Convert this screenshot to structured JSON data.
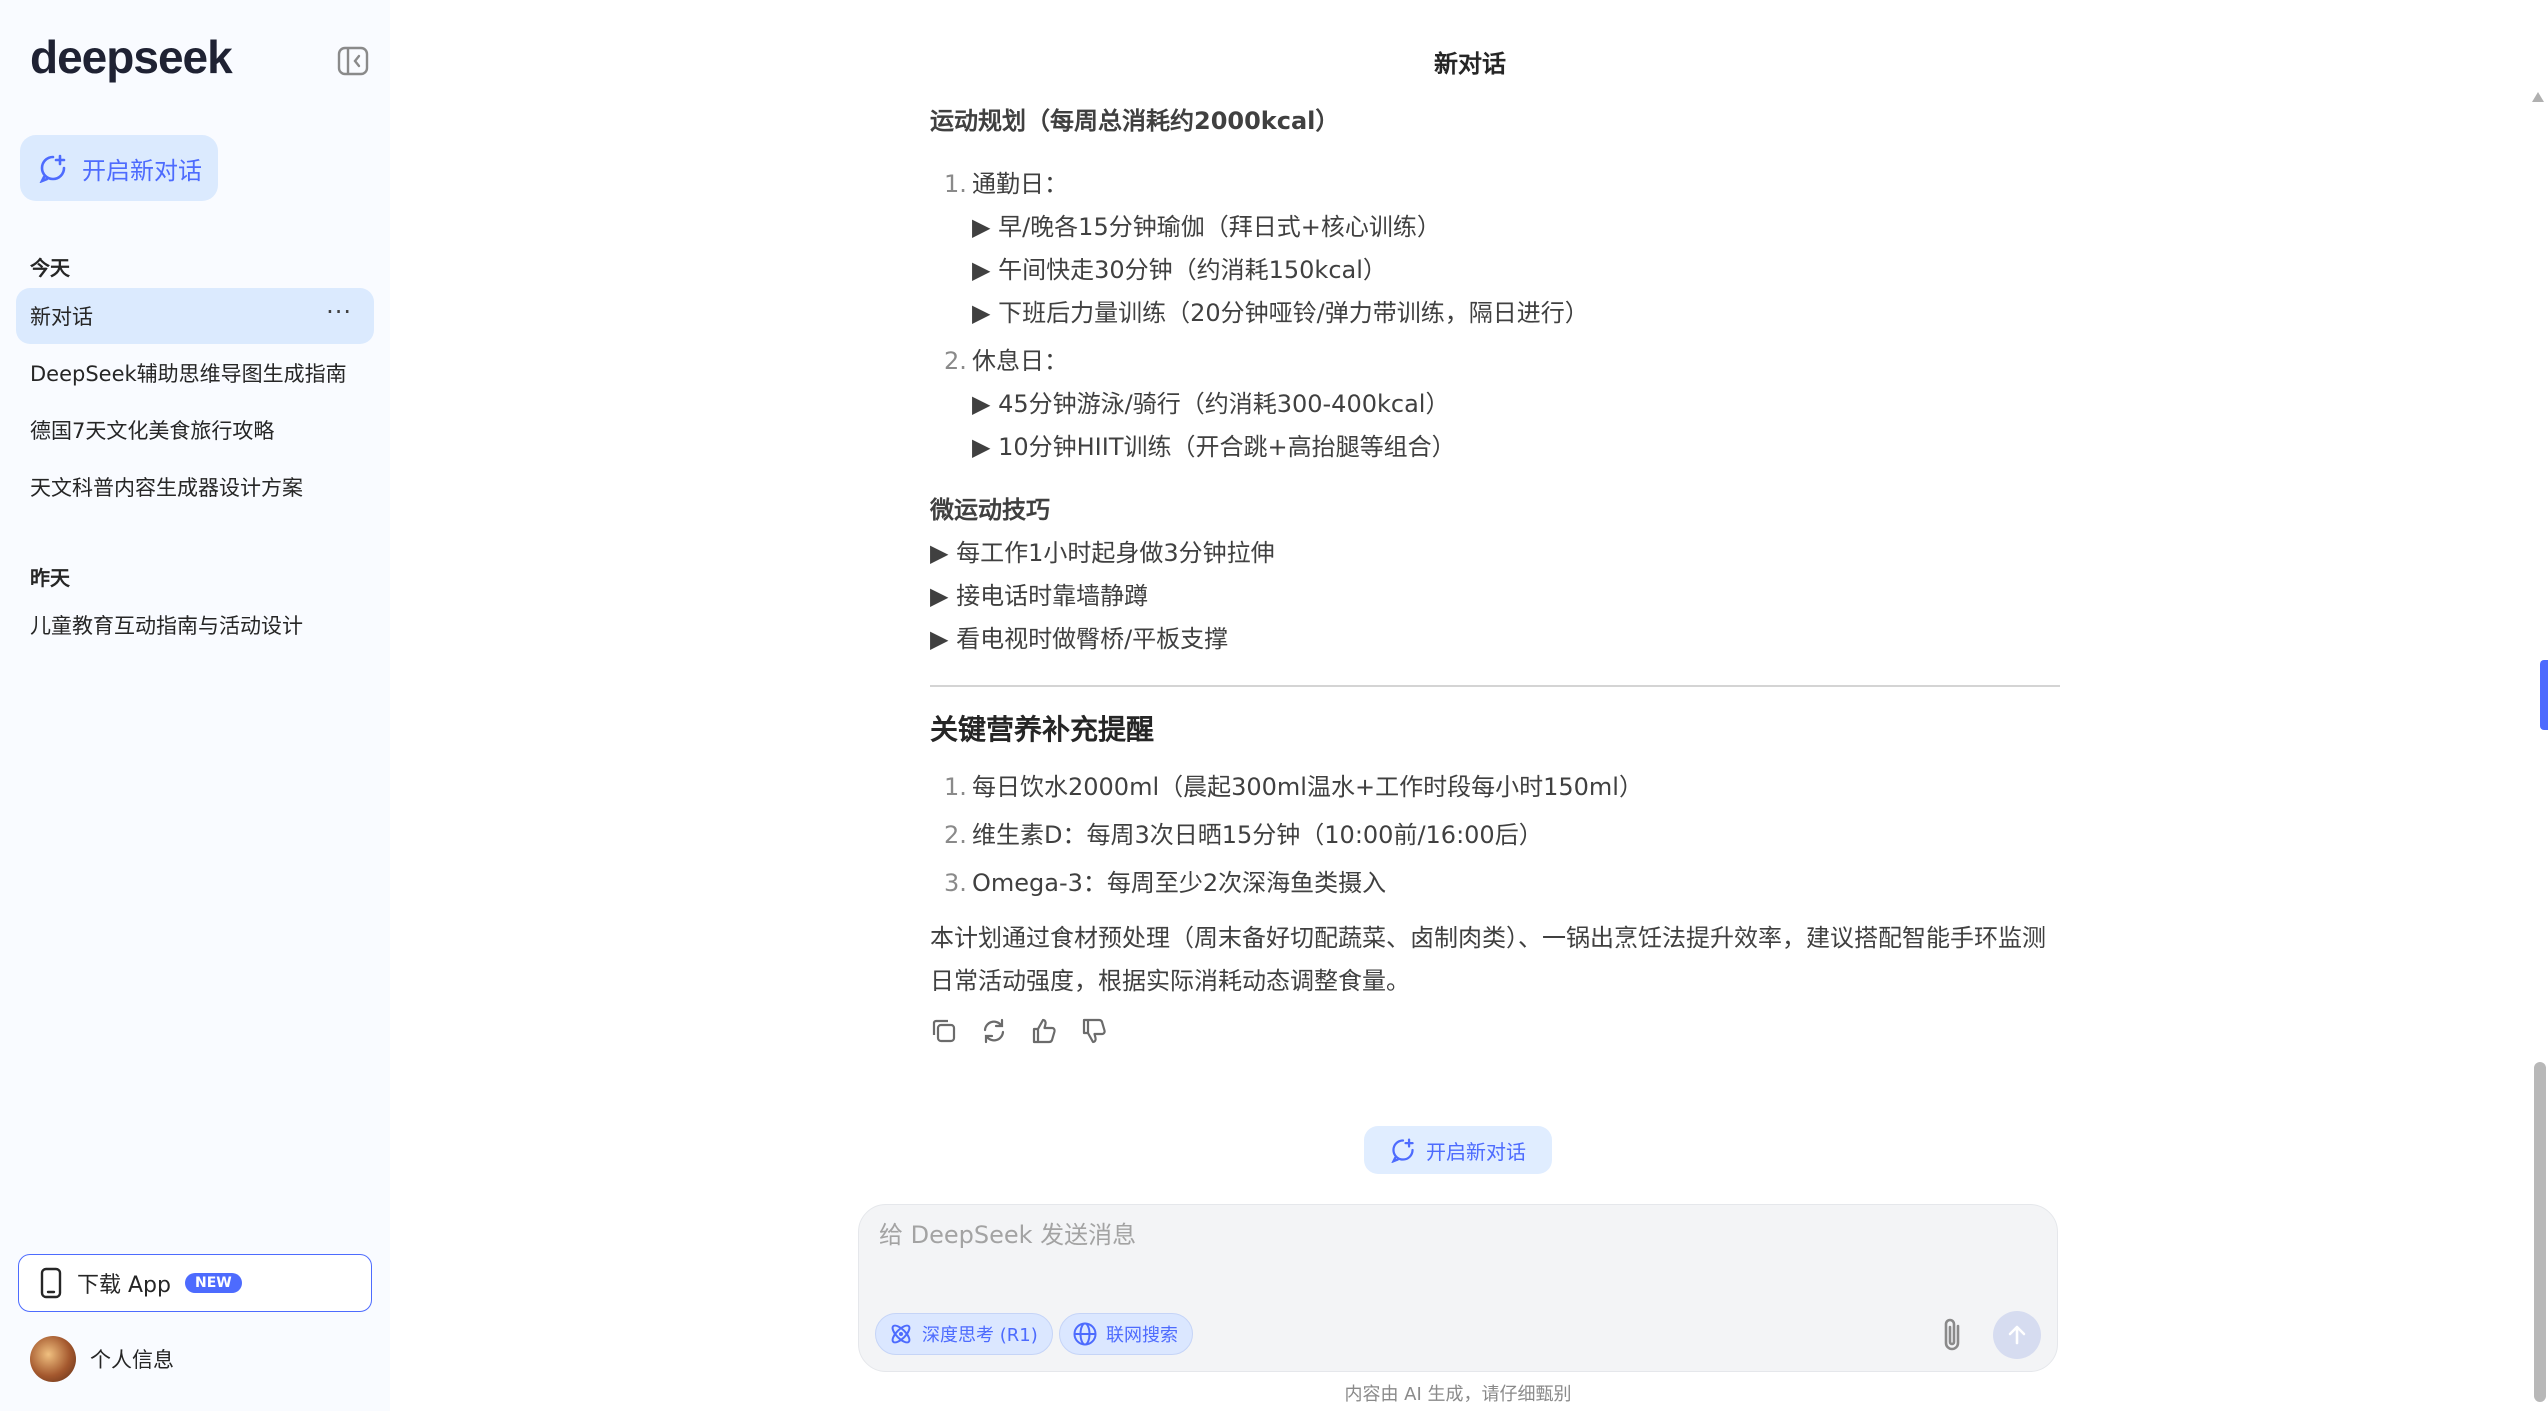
{
  "sidebar": {
    "logo": "deepseek",
    "new_chat_label": "开启新对话",
    "sections": [
      {
        "label": "今天",
        "items": [
          "新对话",
          "DeepSeek辅助思维导图生成指南",
          "德国7天文化美食旅行攻略",
          "天文科普内容生成器设计方案"
        ]
      },
      {
        "label": "昨天",
        "items": [
          "儿童教育互动指南与活动设计"
        ]
      }
    ],
    "active_item_dots": "···",
    "download_label": "下载 App",
    "download_badge": "NEW",
    "profile_label": "个人信息"
  },
  "main": {
    "title": "新对话",
    "exercise_heading": "运动规划（每周总消耗约2000kcal）",
    "exercise_list": [
      {
        "num": "1.",
        "label": "通勤日：",
        "items": [
          "▶ 早/晚各15分钟瑜伽（拜日式+核心训练）",
          "▶ 午间快走30分钟（约消耗150kcal）",
          "▶ 下班后力量训练（20分钟哑铃/弹力带训练，隔日进行）"
        ]
      },
      {
        "num": "2.",
        "label": "休息日：",
        "items": [
          "▶ 45分钟游泳/骑行（约消耗300-400kcal）",
          "▶ 10分钟HIIT训练（开合跳+高抬腿等组合）"
        ]
      }
    ],
    "micro_heading": "微运动技巧",
    "micro_items": [
      "▶ 每工作1小时起身做3分钟拉伸",
      "▶ 接电话时靠墙静蹲",
      "▶ 看电视时做臀桥/平板支撑"
    ],
    "nutrition_heading": "关键营养补充提醒",
    "nutrition_list": [
      {
        "num": "1.",
        "text": "每日饮水2000ml（晨起300ml温水+工作时段每小时150ml）"
      },
      {
        "num": "2.",
        "text": "维生素D：每周3次日晒15分钟（10:00前/16:00后）"
      },
      {
        "num": "3.",
        "text": "Omega-3：每周至少2次深海鱼类摄入"
      }
    ],
    "summary": "本计划通过食材预处理（周末备好切配蔬菜、卤制肉类）、一锅出烹饪法提升效率，建议搭配智能手环监测日常活动强度，根据实际消耗动态调整食量。",
    "new_chat_pill": "开启新对话"
  },
  "input": {
    "placeholder": "给 DeepSeek 发送消息",
    "deep_think_label": "深度思考 (R1)",
    "web_search_label": "联网搜索"
  },
  "footnote": "内容由 AI 生成，请仔细甄别",
  "colors": {
    "accent": "#4d6bfe",
    "sidebar_bg": "#f9fbff",
    "active_bg": "#dbeafe"
  }
}
